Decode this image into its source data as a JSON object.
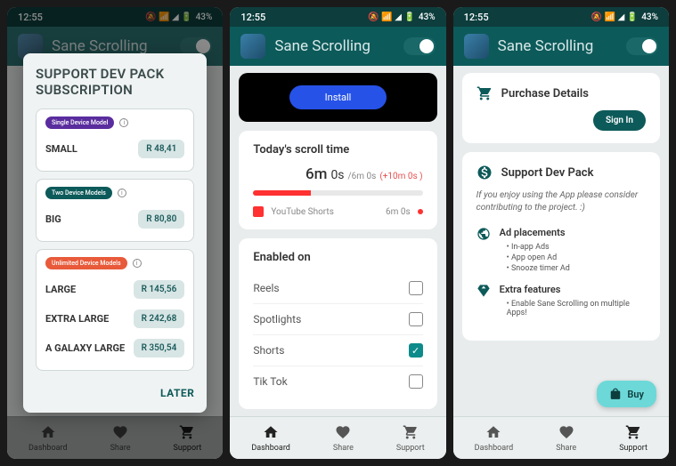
{
  "status": {
    "time": "12:55",
    "battery": "43%"
  },
  "app_name": "Sane Scrolling",
  "dialog": {
    "title": "SUPPORT DEV PACK SUBSCRIPTION",
    "groups": [
      {
        "badge": "Single Device Model",
        "badge_color": "#5a2d9e",
        "tiers": [
          {
            "name": "SMALL",
            "price": "R 48,41"
          }
        ]
      },
      {
        "badge": "Two Device Models",
        "badge_color": "#0d5a5a",
        "tiers": [
          {
            "name": "BIG",
            "price": "R 80,80"
          }
        ]
      },
      {
        "badge": "Unlimited Device Models",
        "badge_color": "#e85a3a",
        "tiers": [
          {
            "name": "LARGE",
            "price": "R 145,56"
          },
          {
            "name": "EXTRA LARGE",
            "price": "R 242,68"
          },
          {
            "name": "A GALAXY LARGE",
            "price": "R 350,54"
          }
        ]
      }
    ],
    "later": "LATER"
  },
  "install_label": "Install",
  "scroll": {
    "title": "Today's scroll time",
    "big_m": "6m ",
    "big_s": "0s ",
    "limit": "/6m 0s",
    "delta": "(+10m 0s )",
    "platform": "YouTube Shorts",
    "platform_time": "6m 0s"
  },
  "enabled": {
    "title": "Enabled on",
    "items": [
      {
        "name": "Reels",
        "checked": false
      },
      {
        "name": "Spotlights",
        "checked": false
      },
      {
        "name": "Shorts",
        "checked": true
      },
      {
        "name": "Tik Tok",
        "checked": false
      }
    ]
  },
  "purchase": {
    "title": "Purchase Details",
    "signin": "Sign In"
  },
  "support": {
    "title": "Support Dev Pack",
    "text": "If you enjoy using the App please consider contributing to the project. :)",
    "ads_title": "Ad placements",
    "ads": [
      "In-app Ads",
      "App open Ad",
      "Snooze timer Ad"
    ],
    "extra_title": "Extra features",
    "extras": [
      "Enable Sane Scrolling on multiple Apps!"
    ]
  },
  "buy": "Buy",
  "nav": {
    "dashboard": "Dashboard",
    "share": "Share",
    "support": "Support"
  }
}
